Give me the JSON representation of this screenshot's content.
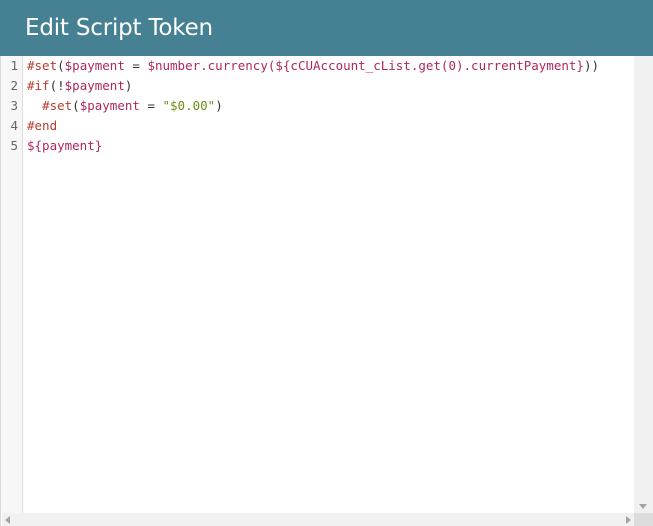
{
  "dialog": {
    "title": "Edit Script Token"
  },
  "editor": {
    "line_numbers": [
      "1",
      "2",
      "3",
      "4",
      "5"
    ],
    "lines": [
      [
        {
          "t": "#set",
          "k": "kw"
        },
        {
          "t": "(",
          "k": "plain"
        },
        {
          "t": "$payment",
          "k": "var"
        },
        {
          "t": " = ",
          "k": "plain"
        },
        {
          "t": "$number.currency(${cCUAccount_cList.get(0).currentPayment}",
          "k": "var"
        },
        {
          "t": "))",
          "k": "plain"
        }
      ],
      [
        {
          "t": "#if",
          "k": "kw"
        },
        {
          "t": "(!",
          "k": "plain"
        },
        {
          "t": "$payment",
          "k": "var"
        },
        {
          "t": ")",
          "k": "plain"
        }
      ],
      [
        {
          "t": "  ",
          "k": "plain"
        },
        {
          "t": "#set",
          "k": "kw"
        },
        {
          "t": "(",
          "k": "plain"
        },
        {
          "t": "$payment",
          "k": "var"
        },
        {
          "t": " = ",
          "k": "plain"
        },
        {
          "t": "\"$0.00\"",
          "k": "str"
        },
        {
          "t": ")",
          "k": "plain"
        }
      ],
      [
        {
          "t": "#end",
          "k": "kw"
        }
      ],
      [
        {
          "t": "${payment}",
          "k": "var"
        }
      ]
    ]
  },
  "colors": {
    "title_bar": "#468193",
    "keyword": "#b73d2e",
    "variable": "#b0275d",
    "string": "#6b8e13",
    "plain": "#333333"
  },
  "icons": [
    "scroll-down-arrow-icon",
    "scroll-left-arrow-icon",
    "scroll-right-arrow-icon"
  ]
}
